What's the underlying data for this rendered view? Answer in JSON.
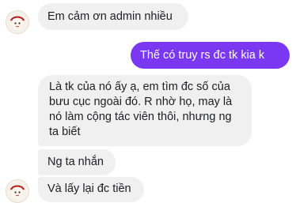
{
  "messages": [
    {
      "from": "contact",
      "text": "Em cảm ơn admin nhiều"
    },
    {
      "from": "me",
      "text": "Thế có truy rs đc tk kia k"
    },
    {
      "from": "contact",
      "text": "Là tk của nó ấy ạ, em tìm đc số của bưu cục ngoài đó. R nhờ họ, may là nó làm cộng tác viên thôi, nhưng ng ta biết"
    },
    {
      "from": "contact",
      "text": "Ng ta nhắn"
    },
    {
      "from": "contact",
      "text": "Và lấy lại đc tiền"
    }
  ],
  "colors": {
    "incoming_bubble": "#f1f0f0",
    "outgoing_bubble": "#7a38f2"
  },
  "icons": {
    "contact_avatar": "avatar-icon"
  }
}
